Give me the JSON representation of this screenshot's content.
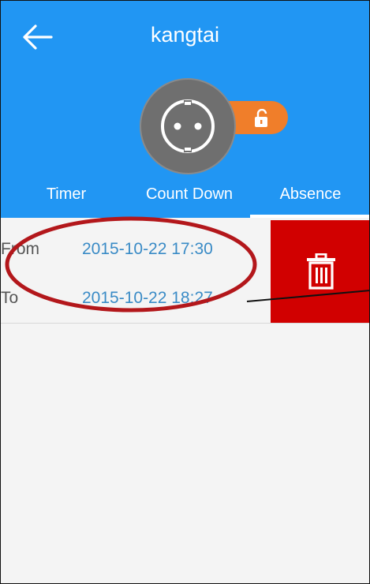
{
  "header": {
    "title": "kangtai",
    "back_icon": "arrow-left-icon",
    "device_icon": "power-socket-icon",
    "lock_state": "unlocked",
    "lock_icon": "padlock-open-icon",
    "bg_color": "#2196f3",
    "accent_color": "#f07e2a"
  },
  "tabs": [
    {
      "label": "Timer"
    },
    {
      "label": "Count Down"
    },
    {
      "label": "Absence",
      "selected": true
    }
  ],
  "absence_entry": {
    "from_label": "From",
    "from_value": "2015-10-22 17:30",
    "to_label": "To",
    "to_value": "2015-10-22 18:27"
  },
  "delete_action": {
    "icon": "trash-icon",
    "bg_color": "#d10000"
  }
}
